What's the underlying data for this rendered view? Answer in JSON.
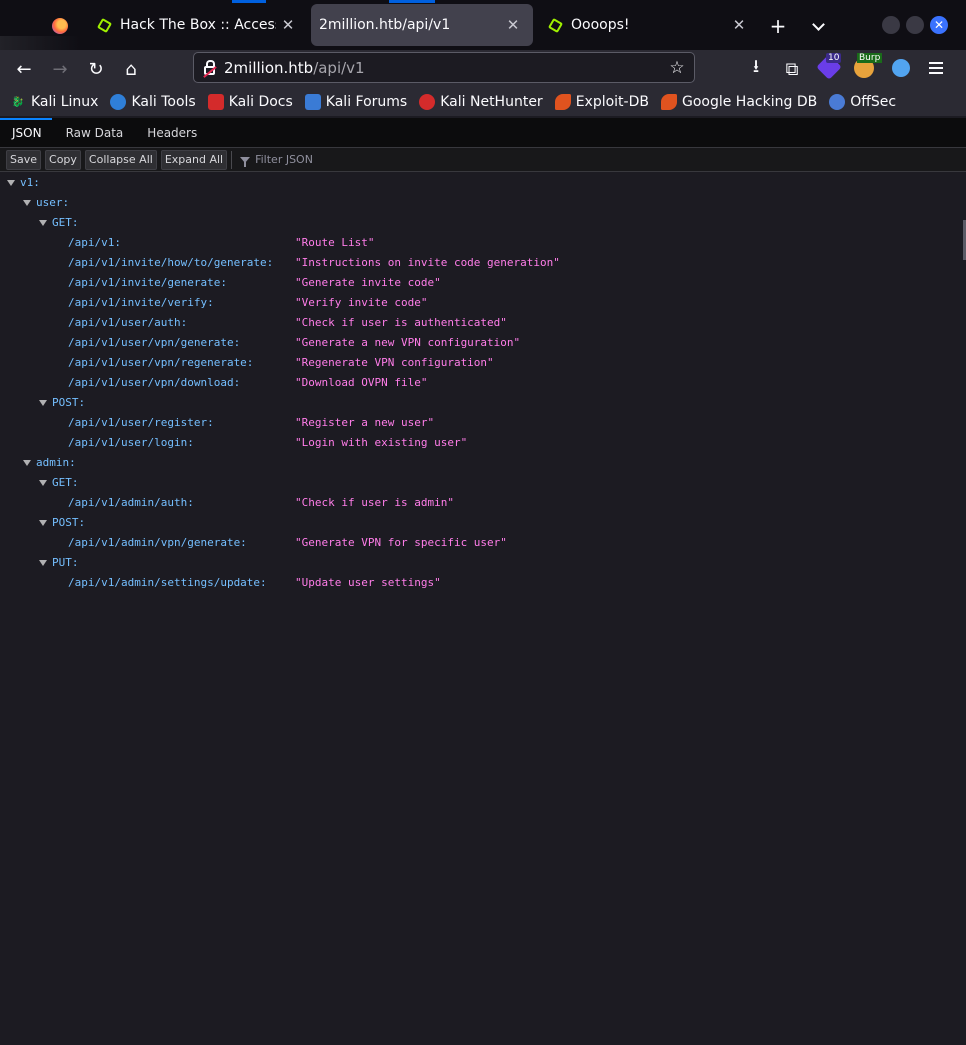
{
  "tabs": [
    {
      "label": "Hack The Box :: Access",
      "close": "✕"
    },
    {
      "label": "2million.htb/api/v1",
      "close": "✕"
    },
    {
      "label": "Oooops!",
      "close": "✕"
    }
  ],
  "new_tab": "+",
  "nav": {
    "url_host": "2million.htb",
    "url_path": "/api/v1",
    "back": "←",
    "forward": "→",
    "reload": "↻",
    "home": "⌂",
    "star": "☆",
    "download": "⭳",
    "extensions": "⧉",
    "ext_badge_count": "10",
    "burp_label": "Burp"
  },
  "bookmarks": [
    {
      "label": "Kali Linux",
      "icon": "kali-dragon-icon",
      "color": "#ffffff"
    },
    {
      "label": "Kali Tools",
      "icon": "kali-tools-icon",
      "color": "#2f7fd8"
    },
    {
      "label": "Kali Docs",
      "icon": "kali-docs-icon",
      "color": "#d42b2b"
    },
    {
      "label": "Kali Forums",
      "icon": "kali-forums-icon",
      "color": "#3a7bd5"
    },
    {
      "label": "Kali NetHunter",
      "icon": "nethunter-icon",
      "color": "#d42b2b"
    },
    {
      "label": "Exploit-DB",
      "icon": "exploit-db-icon",
      "color": "#e0531f"
    },
    {
      "label": "Google Hacking DB",
      "icon": "ghdb-icon",
      "color": "#e0531f"
    },
    {
      "label": "OffSec",
      "icon": "offsec-icon",
      "color": "#4a7bd5"
    }
  ],
  "viewer": {
    "tabs": [
      "JSON",
      "Raw Data",
      "Headers"
    ],
    "buttons": {
      "save": "Save",
      "copy": "Copy",
      "collapse": "Collapse All",
      "expand": "Expand All"
    },
    "filter_placeholder": "Filter JSON"
  },
  "tree": {
    "v1": "v1:",
    "user": "user:",
    "user_get": "GET:",
    "user_get_routes": [
      {
        "route": "/api/v1:",
        "desc": "\"Route List\""
      },
      {
        "route": "/api/v1/invite/how/to/generate:",
        "desc": "\"Instructions on invite code generation\""
      },
      {
        "route": "/api/v1/invite/generate:",
        "desc": "\"Generate invite code\""
      },
      {
        "route": "/api/v1/invite/verify:",
        "desc": "\"Verify invite code\""
      },
      {
        "route": "/api/v1/user/auth:",
        "desc": "\"Check if user is authenticated\""
      },
      {
        "route": "/api/v1/user/vpn/generate:",
        "desc": "\"Generate a new VPN configuration\""
      },
      {
        "route": "/api/v1/user/vpn/regenerate:",
        "desc": "\"Regenerate VPN configuration\""
      },
      {
        "route": "/api/v1/user/vpn/download:",
        "desc": "\"Download OVPN file\""
      }
    ],
    "user_post": "POST:",
    "user_post_routes": [
      {
        "route": "/api/v1/user/register:",
        "desc": "\"Register a new user\""
      },
      {
        "route": "/api/v1/user/login:",
        "desc": "\"Login with existing user\""
      }
    ],
    "admin": "admin:",
    "admin_get": "GET:",
    "admin_get_routes": [
      {
        "route": "/api/v1/admin/auth:",
        "desc": "\"Check if user is admin\""
      }
    ],
    "admin_post": "POST:",
    "admin_post_routes": [
      {
        "route": "/api/v1/admin/vpn/generate:",
        "desc": "\"Generate VPN for specific user\""
      }
    ],
    "admin_put": "PUT:",
    "admin_put_routes": [
      {
        "route": "/api/v1/admin/settings/update:",
        "desc": "\"Update user settings\""
      }
    ]
  }
}
